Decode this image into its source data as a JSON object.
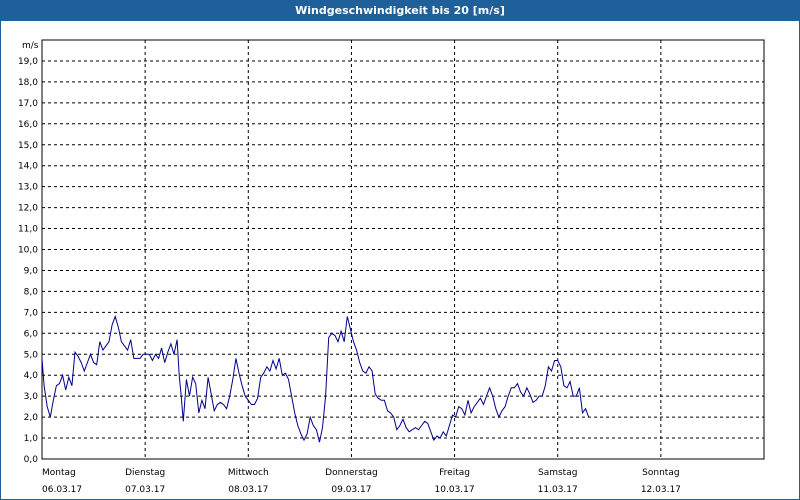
{
  "window": {
    "title": "Windgeschwindigkeit bis 20 [m/s]"
  },
  "colors": {
    "titlebar": "#1f5f9a",
    "line": "#00008b",
    "grid": "#000000"
  },
  "chart_data": {
    "type": "line",
    "title": "Windgeschwindigkeit bis 20 [m/s]",
    "ylabel": "m/s",
    "ylim": [
      0,
      20
    ],
    "yticks": [
      "0,0",
      "1,0",
      "2,0",
      "3,0",
      "4,0",
      "5,0",
      "6,0",
      "7,0",
      "8,0",
      "9,0",
      "10,0",
      "11,0",
      "12,0",
      "13,0",
      "14,0",
      "15,0",
      "16,0",
      "17,0",
      "18,0",
      "19,0"
    ],
    "xlim": [
      0,
      7
    ],
    "days": [
      {
        "day": "Montag",
        "date": "06.03.17"
      },
      {
        "day": "Dienstag",
        "date": "07.03.17"
      },
      {
        "day": "Mittwoch",
        "date": "08.03.17"
      },
      {
        "day": "Donnerstag",
        "date": "09.03.17"
      },
      {
        "day": "Freitag",
        "date": "10.03.17"
      },
      {
        "day": "Samstag",
        "date": "11.03.17"
      },
      {
        "day": "Sonntag",
        "date": "12.03.17"
      }
    ],
    "grid": true,
    "series": [
      {
        "values": [
          [
            0.0,
            4.8
          ],
          [
            0.02,
            3.5
          ],
          [
            0.05,
            2.5
          ],
          [
            0.08,
            2.0
          ],
          [
            0.11,
            2.8
          ],
          [
            0.14,
            3.5
          ],
          [
            0.17,
            3.6
          ],
          [
            0.2,
            4.0
          ],
          [
            0.23,
            3.3
          ],
          [
            0.26,
            3.9
          ],
          [
            0.29,
            3.5
          ],
          [
            0.32,
            5.1
          ],
          [
            0.35,
            4.9
          ],
          [
            0.38,
            4.6
          ],
          [
            0.41,
            4.2
          ],
          [
            0.44,
            4.6
          ],
          [
            0.47,
            5.0
          ],
          [
            0.5,
            4.6
          ],
          [
            0.53,
            4.5
          ],
          [
            0.56,
            5.6
          ],
          [
            0.59,
            5.2
          ],
          [
            0.62,
            5.4
          ],
          [
            0.65,
            5.6
          ],
          [
            0.68,
            6.4
          ],
          [
            0.71,
            6.8
          ],
          [
            0.74,
            6.3
          ],
          [
            0.77,
            5.6
          ],
          [
            0.8,
            5.4
          ],
          [
            0.83,
            5.2
          ],
          [
            0.86,
            5.7
          ],
          [
            0.89,
            4.8
          ],
          [
            0.92,
            4.8
          ],
          [
            0.95,
            4.8
          ],
          [
            0.98,
            5.0
          ],
          [
            1.01,
            5.0
          ],
          [
            1.04,
            5.0
          ],
          [
            1.07,
            4.7
          ],
          [
            1.1,
            5.0
          ],
          [
            1.13,
            4.8
          ],
          [
            1.16,
            5.3
          ],
          [
            1.19,
            4.6
          ],
          [
            1.22,
            5.1
          ],
          [
            1.25,
            5.5
          ],
          [
            1.28,
            5.0
          ],
          [
            1.31,
            5.7
          ],
          [
            1.33,
            4.0
          ],
          [
            1.35,
            3.0
          ],
          [
            1.37,
            1.8
          ],
          [
            1.4,
            3.8
          ],
          [
            1.43,
            3.0
          ],
          [
            1.46,
            3.9
          ],
          [
            1.49,
            3.6
          ],
          [
            1.52,
            2.2
          ],
          [
            1.55,
            2.8
          ],
          [
            1.58,
            2.4
          ],
          [
            1.61,
            3.9
          ],
          [
            1.64,
            3.1
          ],
          [
            1.67,
            2.3
          ],
          [
            1.7,
            2.6
          ],
          [
            1.73,
            2.7
          ],
          [
            1.76,
            2.6
          ],
          [
            1.79,
            2.4
          ],
          [
            1.82,
            3.0
          ],
          [
            1.85,
            3.8
          ],
          [
            1.88,
            4.8
          ],
          [
            1.91,
            4.1
          ],
          [
            1.94,
            3.5
          ],
          [
            1.97,
            3.0
          ],
          [
            2.0,
            2.8
          ],
          [
            2.03,
            2.6
          ],
          [
            2.06,
            2.6
          ],
          [
            2.09,
            2.9
          ],
          [
            2.12,
            3.9
          ],
          [
            2.15,
            4.1
          ],
          [
            2.18,
            4.4
          ],
          [
            2.21,
            4.2
          ],
          [
            2.24,
            4.7
          ],
          [
            2.27,
            4.3
          ],
          [
            2.3,
            4.8
          ],
          [
            2.33,
            4.0
          ],
          [
            2.36,
            4.1
          ],
          [
            2.39,
            3.8
          ],
          [
            2.42,
            3.0
          ],
          [
            2.45,
            2.2
          ],
          [
            2.48,
            1.6
          ],
          [
            2.51,
            1.2
          ],
          [
            2.54,
            0.9
          ],
          [
            2.57,
            1.2
          ],
          [
            2.6,
            2.0
          ],
          [
            2.63,
            1.6
          ],
          [
            2.66,
            1.4
          ],
          [
            2.69,
            0.8
          ],
          [
            2.72,
            1.5
          ],
          [
            2.75,
            3.0
          ],
          [
            2.78,
            5.8
          ],
          [
            2.81,
            6.0
          ],
          [
            2.84,
            5.9
          ],
          [
            2.87,
            5.6
          ],
          [
            2.9,
            6.1
          ],
          [
            2.93,
            5.6
          ],
          [
            2.96,
            6.8
          ],
          [
            2.99,
            6.2
          ],
          [
            3.02,
            5.6
          ],
          [
            3.05,
            5.2
          ],
          [
            3.08,
            4.6
          ],
          [
            3.11,
            4.2
          ],
          [
            3.14,
            4.1
          ],
          [
            3.17,
            4.4
          ],
          [
            3.2,
            4.2
          ],
          [
            3.23,
            3.1
          ],
          [
            3.26,
            2.9
          ],
          [
            3.29,
            2.8
          ],
          [
            3.32,
            2.8
          ],
          [
            3.35,
            2.3
          ],
          [
            3.38,
            2.2
          ],
          [
            3.41,
            2.0
          ],
          [
            3.44,
            1.4
          ],
          [
            3.47,
            1.6
          ],
          [
            3.5,
            1.9
          ],
          [
            3.53,
            1.5
          ],
          [
            3.56,
            1.3
          ],
          [
            3.59,
            1.4
          ],
          [
            3.62,
            1.5
          ],
          [
            3.65,
            1.4
          ],
          [
            3.68,
            1.6
          ],
          [
            3.71,
            1.8
          ],
          [
            3.74,
            1.7
          ],
          [
            3.77,
            1.3
          ],
          [
            3.8,
            0.9
          ],
          [
            3.83,
            1.1
          ],
          [
            3.86,
            1.0
          ],
          [
            3.89,
            1.3
          ],
          [
            3.92,
            1.1
          ],
          [
            3.95,
            1.6
          ],
          [
            3.98,
            2.1
          ],
          [
            4.01,
            2.0
          ],
          [
            4.04,
            2.5
          ],
          [
            4.07,
            2.4
          ],
          [
            4.1,
            2.1
          ],
          [
            4.13,
            2.8
          ],
          [
            4.16,
            2.2
          ],
          [
            4.19,
            2.5
          ],
          [
            4.22,
            2.7
          ],
          [
            4.25,
            2.9
          ],
          [
            4.28,
            2.6
          ],
          [
            4.31,
            3.0
          ],
          [
            4.34,
            3.4
          ],
          [
            4.37,
            3.0
          ],
          [
            4.4,
            2.4
          ],
          [
            4.43,
            2.0
          ],
          [
            4.46,
            2.3
          ],
          [
            4.49,
            2.5
          ],
          [
            4.52,
            3.0
          ],
          [
            4.55,
            3.4
          ],
          [
            4.58,
            3.4
          ],
          [
            4.61,
            3.6
          ],
          [
            4.64,
            3.2
          ],
          [
            4.67,
            3.0
          ],
          [
            4.7,
            3.4
          ],
          [
            4.73,
            3.1
          ],
          [
            4.76,
            2.7
          ],
          [
            4.79,
            2.8
          ],
          [
            4.82,
            3.0
          ],
          [
            4.85,
            3.0
          ],
          [
            4.88,
            3.5
          ],
          [
            4.91,
            4.4
          ],
          [
            4.94,
            4.2
          ],
          [
            4.97,
            4.7
          ],
          [
            5.0,
            4.7
          ],
          [
            5.03,
            4.4
          ],
          [
            5.06,
            3.5
          ],
          [
            5.09,
            3.4
          ],
          [
            5.12,
            3.7
          ],
          [
            5.15,
            3.0
          ],
          [
            5.18,
            3.0
          ],
          [
            5.21,
            3.4
          ],
          [
            5.24,
            2.2
          ],
          [
            5.27,
            2.4
          ],
          [
            5.3,
            2.0
          ]
        ]
      }
    ]
  }
}
